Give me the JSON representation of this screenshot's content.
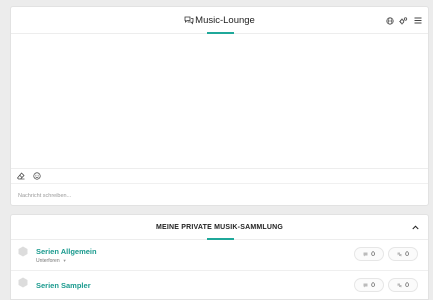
{
  "chat": {
    "title": "Music-Lounge",
    "input_placeholder": "Nachricht schreiben..."
  },
  "icons": {
    "title": "chat-bubbles-icon",
    "header": [
      "globe-icon",
      "settings-icon",
      "menu-icon"
    ],
    "toolbar": [
      "eraser-icon",
      "smiley-icon"
    ],
    "forum": "hexagon-icon",
    "threads": "speech-bubble-icon",
    "posts": "speech-bubbles-icon",
    "collapse": "chevron-up-icon"
  },
  "colors": {
    "accent": "#1fa89a",
    "background": "#ececec"
  },
  "section": {
    "title": "MEINE PRIVATE MUSIK-SAMMLUNG",
    "forums": [
      {
        "name": "Serien Allgemein",
        "subforums_label": "Unterforen",
        "threads": "0",
        "posts": "0"
      },
      {
        "name": "Serien Sampler",
        "threads": "0",
        "posts": "0"
      }
    ]
  }
}
